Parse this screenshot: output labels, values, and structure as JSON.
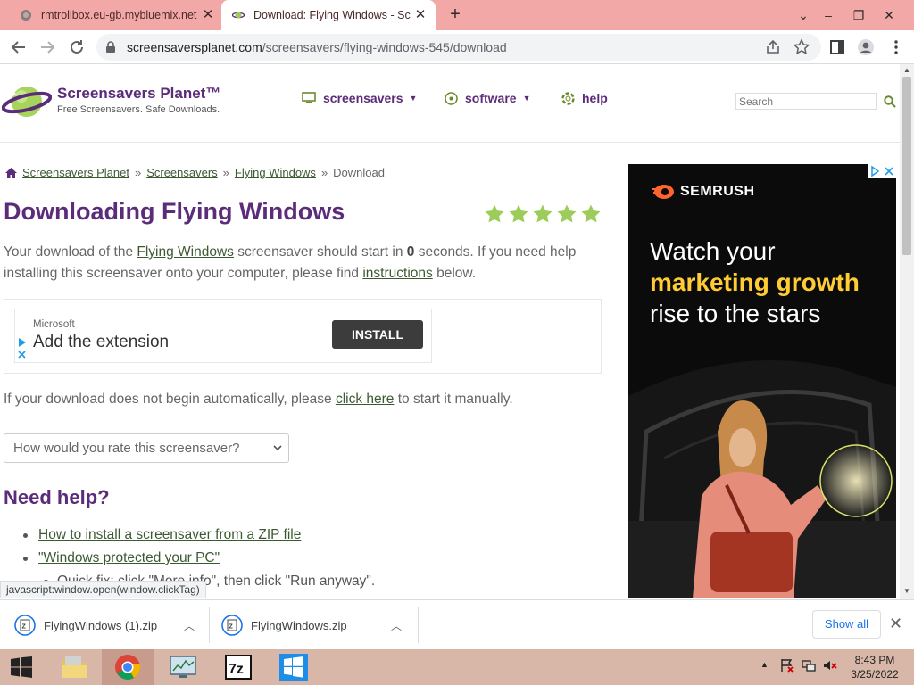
{
  "browser": {
    "tabs": [
      {
        "title": "rmtrollbox.eu-gb.mybluemix.net",
        "active": false
      },
      {
        "title": "Download: Flying Windows - Scre",
        "active": true
      }
    ],
    "url_host": "screensaversplanet.com",
    "url_path": "/screensavers/flying-windows-545/download",
    "status_text": "javascript:window.open(window.clickTag)"
  },
  "site": {
    "logo_title": "Screensavers Planet™",
    "logo_tagline": "Free Screensavers. Safe Downloads.",
    "nav": [
      {
        "label": "screensavers",
        "icon": "monitor-icon"
      },
      {
        "label": "software",
        "icon": "disc-icon"
      },
      {
        "label": "help",
        "icon": "lifebuoy-icon"
      }
    ],
    "search_placeholder": "Search"
  },
  "breadcrumb": [
    "Screensavers Planet",
    "Screensavers",
    "Flying Windows",
    "Download"
  ],
  "page": {
    "title": "Downloading Flying Windows",
    "rating_stars": 5,
    "p1_before": "Your download of the ",
    "p1_link": "Flying Windows",
    "p1_mid1": " screensaver should start in ",
    "p1_seconds": "0",
    "p1_mid2": " seconds. If you need help installing this screensaver onto your computer, please find ",
    "p1_link2": "instructions",
    "p1_after": " below.",
    "p2_before": "If your download does not begin automatically, please ",
    "p2_link": "click here",
    "p2_after": " to start it manually.",
    "rate_select": "How would you rate this screensaver?",
    "help_title": "Need help?",
    "help_links": [
      "How to install a screensaver from a ZIP file",
      "\"Windows protected your PC\""
    ],
    "help_sub": "Quick fix: click \"More info\", then click \"Run anyway\"."
  },
  "inline_ad": {
    "brand": "Microsoft",
    "text": "Add the extension",
    "button": "INSTALL"
  },
  "side_ad": {
    "brand": "SEMRUSH",
    "line1": "Watch your",
    "line2": "marketing growth",
    "line3": "rise to the stars"
  },
  "downloads": {
    "items": [
      "FlyingWindows (1).zip",
      "FlyingWindows.zip"
    ],
    "show_all": "Show all"
  },
  "taskbar": {
    "time": "8:43 PM",
    "date": "3/25/2022"
  },
  "colors": {
    "brand_purple": "#5b2c7a",
    "link_green": "#3c5a32",
    "star_green": "#9ccd5a",
    "tab_strip": "#f2a8a6",
    "semrush_yellow": "#ffcc33"
  }
}
